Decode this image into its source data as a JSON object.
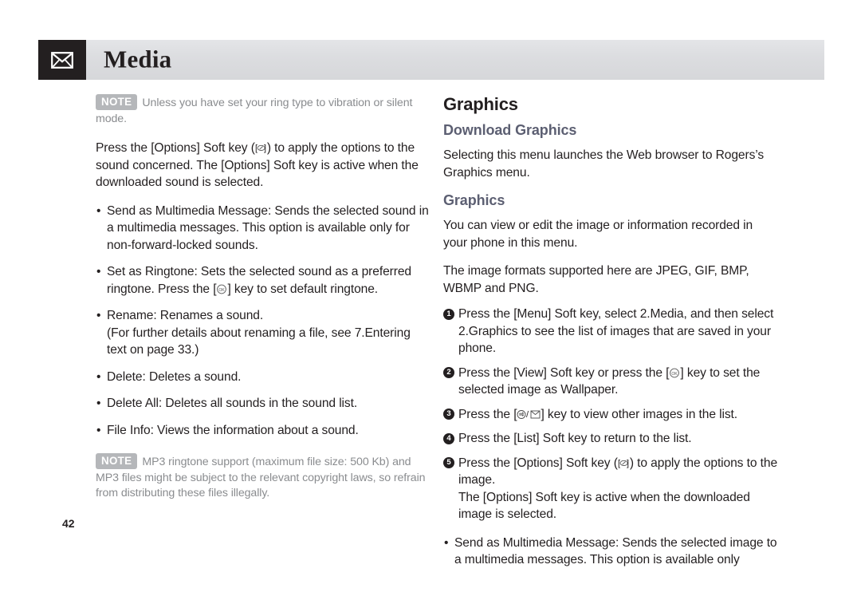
{
  "header": {
    "title": "Media",
    "icon": "envelope-icon"
  },
  "page_number": "42",
  "left_column": {
    "note_top": {
      "badge": "NOTE",
      "text": "Unless you have set your ring type to vibration or silent mode."
    },
    "intro_paragraph_part1": "Press the [Options] Soft key (",
    "intro_paragraph_part2": ") to apply the options to the sound concerned. The [Options] Soft key is active when the downloaded sound is selected.",
    "bullets": [
      {
        "marker": "•",
        "text": "Send as Multimedia Message: Sends the selected sound in a multimedia messages. This option is available only for non-forward-locked sounds."
      },
      {
        "marker": "•",
        "text_part1": "Set as Ringtone: Sets the selected sound as a preferred ringtone. Press the [",
        "text_part2": "] key to set default ringtone."
      },
      {
        "marker": "•",
        "text_line1": "Rename: Renames a sound.",
        "text_line2": "(For further details about renaming a file, see 7.Entering text on page 33.)"
      },
      {
        "marker": "•",
        "text": "Delete: Deletes a sound."
      },
      {
        "marker": "•",
        "text": "Delete All: Deletes all sounds in the sound list."
      },
      {
        "marker": "•",
        "text": "File Info: Views the information about a sound."
      }
    ],
    "note_bottom": {
      "badge": "NOTE",
      "text": "MP3 ringtone support (maximum file size: 500 Kb) and MP3 files might be subject to the relevant copyright laws, so refrain from distributing these files illegally."
    }
  },
  "right_column": {
    "heading_graphics": "Graphics",
    "heading_download_graphics": "Download Graphics",
    "paragraph_download": "Selecting this menu launches the Web browser to Rogers’s Graphics menu.",
    "heading_graphics_sub": "Graphics",
    "paragraph_view_edit": "You can view or edit the image or information recorded in your phone in this menu.",
    "paragraph_formats": "The image formats supported here are JPEG, GIF, BMP, WBMP and PNG.",
    "steps": [
      {
        "number": "1",
        "text": "Press the [Menu] Soft key, select 2.Media, and then select 2.Graphics to see the list of images that are saved in your phone."
      },
      {
        "number": "2",
        "text_part1": "Press the [View] Soft key or press the [",
        "text_part2": "] key to set the selected image as Wallpaper."
      },
      {
        "number": "3",
        "text_part1": "Press the [",
        "text_part2": "] key to view other images in the list."
      },
      {
        "number": "4",
        "text": "Press the [List] Soft key to return to the list."
      },
      {
        "number": "5",
        "text_part1": "Press the [Options] Soft key (",
        "text_part2": ") to apply the options to the image.",
        "text_line2": "The [Options] Soft key is active when the downloaded image is selected."
      }
    ],
    "bullets": [
      {
        "marker": "•",
        "text": "Send as Multimedia Message: Sends the selected image to a multimedia messages. This option is available only"
      }
    ]
  },
  "colors": {
    "header_dark": "#231f20",
    "header_bar": "#dcdde0",
    "heading_accent": "#5c5f72",
    "note_text": "#8a8c8f",
    "note_badge_bg": "#b5b7ba",
    "body_text": "#231f20"
  }
}
